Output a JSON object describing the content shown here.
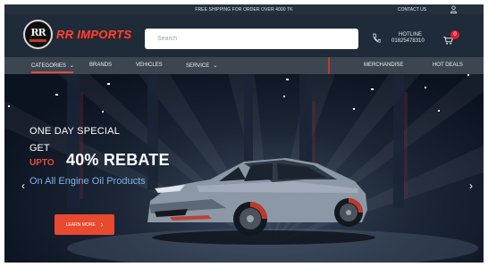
{
  "topbar": {
    "promo": "FREE SHIPPING FOR ORDER OVER 4000 TK",
    "contact": "CONTACT US"
  },
  "header": {
    "logo_badge": "RR",
    "logo_text": "RR IMPORTS",
    "search_placeholder": "Search",
    "hotline_label": "HOTLINE",
    "hotline_number": "01825478310",
    "cart_count": "0"
  },
  "nav": {
    "categories": "CATEGORIES",
    "brands": "BRANDS",
    "vehicles": "VEHICLES",
    "service": "SERVICE",
    "merchandise": "MERCHANDISE",
    "hot_deals": "HOT DEALS"
  },
  "hero": {
    "line1": "ONE DAY SPECIAL",
    "line2": "GET",
    "upto": "UPTO",
    "rebate": "40% REBATE",
    "subtitle": "On All Engine Oil Products",
    "cta": "LEARN MORE",
    "prev": "‹",
    "next": "›"
  },
  "colors": {
    "accent": "#e74c3c",
    "header_bg": "#1f2b38",
    "nav_bg": "#3b4651",
    "cta": "#e8492f",
    "subtitle": "#7fb2e8"
  },
  "icons": [
    "user-icon",
    "phone-icon",
    "cart-icon",
    "chevron-down-icon",
    "chevron-right-icon",
    "arrow-left-icon",
    "arrow-right-icon"
  ]
}
